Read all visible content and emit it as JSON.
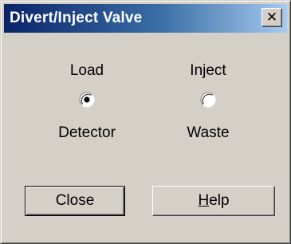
{
  "window": {
    "title": "Divert/Inject Valve",
    "close_glyph": "✕"
  },
  "options": [
    {
      "top_label": "Load",
      "bottom_label": "Detector",
      "selected": true
    },
    {
      "top_label": "Inject",
      "bottom_label": "Waste",
      "selected": false
    }
  ],
  "buttons": {
    "close_label": "Close",
    "help_mnemonic": "H",
    "help_rest": "elp"
  },
  "icons": {
    "title_close": "close-icon",
    "radio_selected": "radio-selected-icon",
    "radio_unselected": "radio-unselected-icon"
  },
  "colors": {
    "face": "#d4d0c8",
    "title_start": "#0a246a",
    "title_end": "#a6caf0"
  }
}
